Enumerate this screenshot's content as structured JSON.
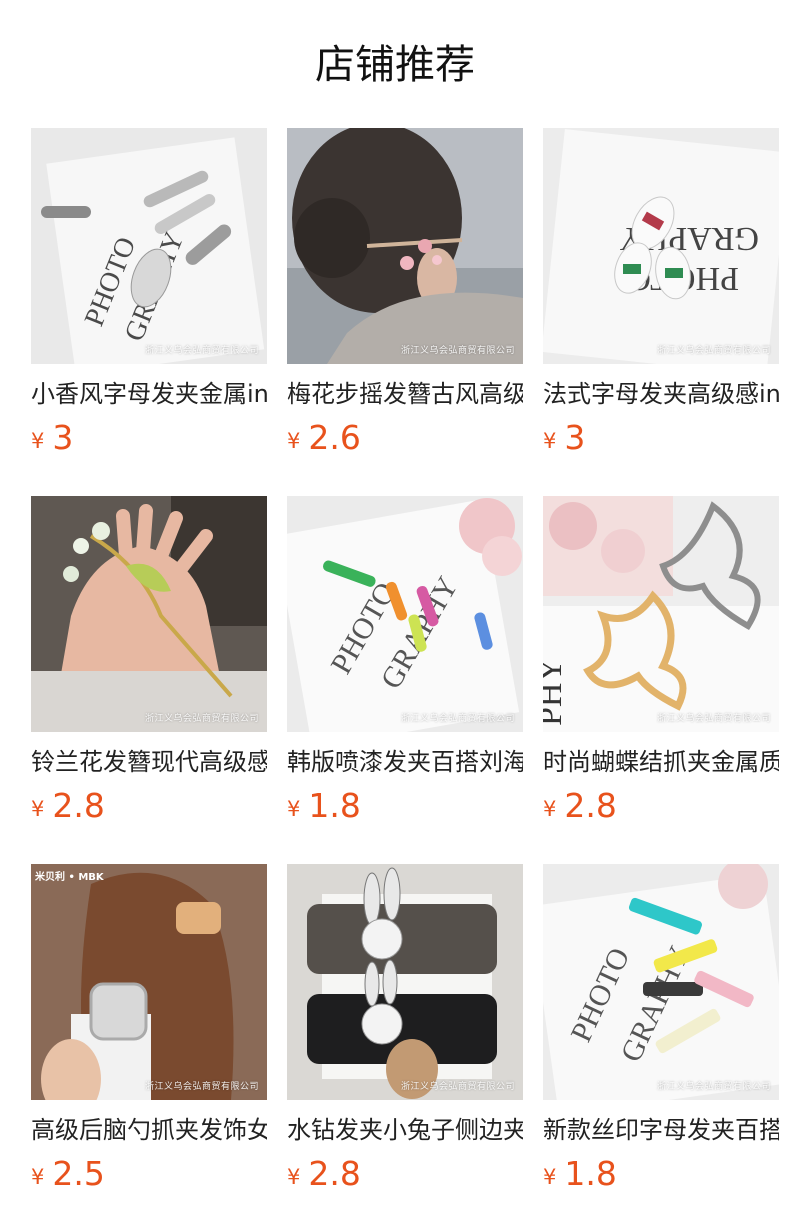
{
  "page": {
    "title": "店铺推荐"
  },
  "currency_symbol": "¥",
  "watermark_text": "浙江义乌会弘商贸有限公司",
  "products": [
    {
      "title": "小香风字母发夹金属ins",
      "price": "3",
      "image": "silver-letter-hair-clips-photo"
    },
    {
      "title": "梅花步摇发簪古风高级感",
      "price": "2.6",
      "image": "plum-blossom-hairpin-photo"
    },
    {
      "title": "法式字母发夹高级感ins",
      "price": "3",
      "image": "french-letter-hair-clips-photo"
    },
    {
      "title": "铃兰花发簪现代高级感",
      "price": "2.8",
      "image": "lily-of-the-valley-hairpin-photo"
    },
    {
      "title": "韩版喷漆发夹百搭刘海夹",
      "price": "1.8",
      "image": "painted-hair-clips-photo"
    },
    {
      "title": "时尚蝴蝶结抓夹金属质感",
      "price": "2.8",
      "image": "butterfly-claw-clips-photo"
    },
    {
      "title": "高级后脑勺抓夹发饰女",
      "price": "2.5",
      "image": "back-head-claw-clip-photo",
      "brand_text": "米贝利 • MBK"
    },
    {
      "title": "水钻发夹小兔子侧边夹",
      "price": "2.8",
      "image": "rhinestone-bunny-clips-photo"
    },
    {
      "title": "新款丝印字母发夹百搭",
      "price": "1.8",
      "image": "printed-letter-hair-clips-photo"
    }
  ]
}
